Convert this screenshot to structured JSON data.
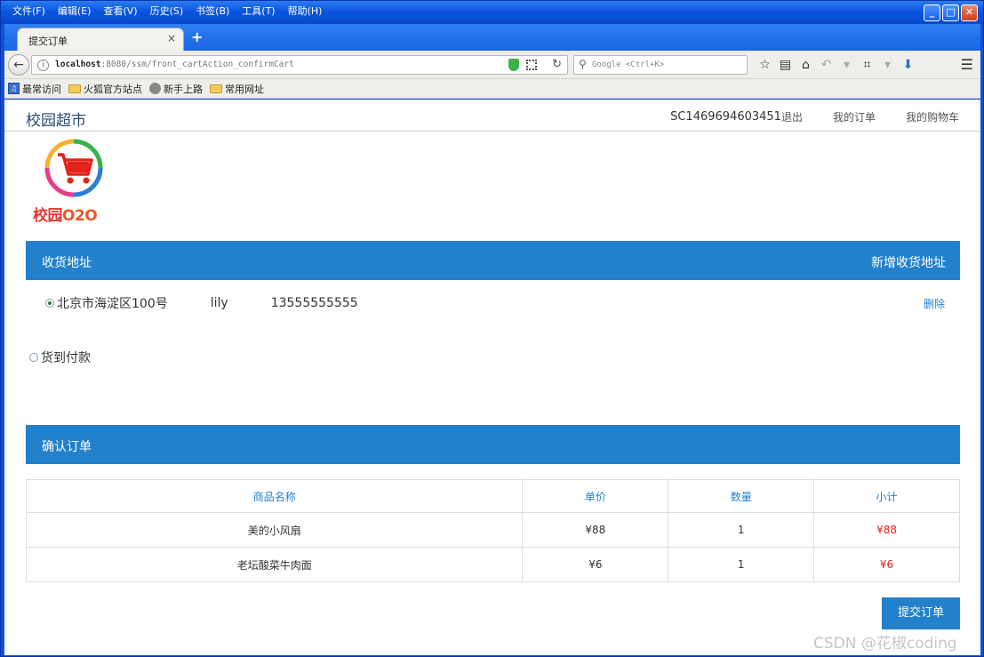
{
  "browser": {
    "menus": [
      "文件(F)",
      "编辑(E)",
      "查看(V)",
      "历史(S)",
      "书签(B)",
      "工具(T)",
      "帮助(H)"
    ],
    "tab_title": "提交订单",
    "tab_close": "×",
    "new_tab": "+",
    "url_host": "localhost",
    "url_rest": ":8080/ssm/front_cartAction_confirmCart",
    "search_placeholder": "Google <Ctrl+K>",
    "bookmarks": [
      "最常访问",
      "火狐官方站点",
      "新手上路",
      "常用网址"
    ]
  },
  "site": {
    "brand": "校园超市",
    "user": "SC1469694603451",
    "logout": "退出",
    "my_orders": "我的订单",
    "my_cart": "我的购物车",
    "logo_text_a": "校园",
    "logo_text_b": "O2O"
  },
  "address_section": {
    "title": "收货地址",
    "add_label": "新增收货地址",
    "address": "北京市海淀区100号",
    "name": "lily",
    "phone": "13555555555",
    "delete_label": "删除"
  },
  "payment": {
    "option": "货到付款"
  },
  "confirm_section": {
    "title": "确认订单"
  },
  "table": {
    "headers": [
      "商品名称",
      "单价",
      "数量",
      "小计"
    ],
    "rows": [
      [
        "美的小风扇",
        "¥88",
        "1",
        "¥88"
      ],
      [
        "老坛酸菜牛肉面",
        "¥6",
        "1",
        "¥6"
      ]
    ]
  },
  "submit_label": "提交订单",
  "watermark": "CSDN @花椒coding",
  "colors": {
    "accent": "#2381cb",
    "price_red": "#e2231a",
    "brand_text": "#2a4a72"
  }
}
